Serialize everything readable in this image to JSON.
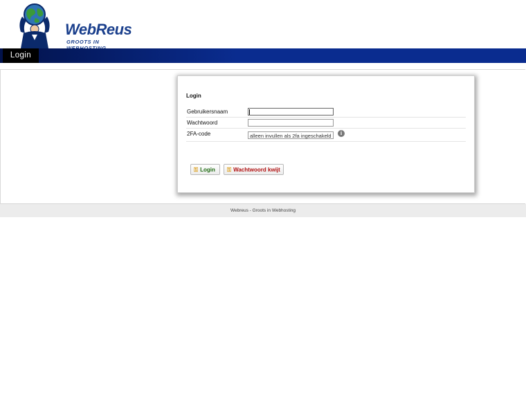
{
  "header": {
    "logo_text": "WebReus",
    "logo_tagline": "GROOTS IN WEBHOSTING"
  },
  "nav": {
    "tabs": [
      {
        "label": "Login"
      }
    ]
  },
  "login_panel": {
    "title": "Login",
    "fields": {
      "username": {
        "label": "Gebruikersnaam",
        "value": ""
      },
      "password": {
        "label": "Wachtwoord",
        "value": ""
      },
      "twofa": {
        "label": "2FA-code",
        "placeholder": "alleen invullen als 2fa ingeschakeld",
        "info_icon": "info-icon"
      }
    },
    "buttons": {
      "login": {
        "label": "Login",
        "icon": "key-icon",
        "color": "#1f6b12"
      },
      "forgot": {
        "label": "Wachtwoord kwijt",
        "icon": "key-icon",
        "color": "#b01010"
      }
    }
  },
  "footer": {
    "text": "Webreus - Groots in Webhosting"
  },
  "colors": {
    "brand_blue": "#0a2c8f",
    "nav_dark": "#02124a"
  }
}
